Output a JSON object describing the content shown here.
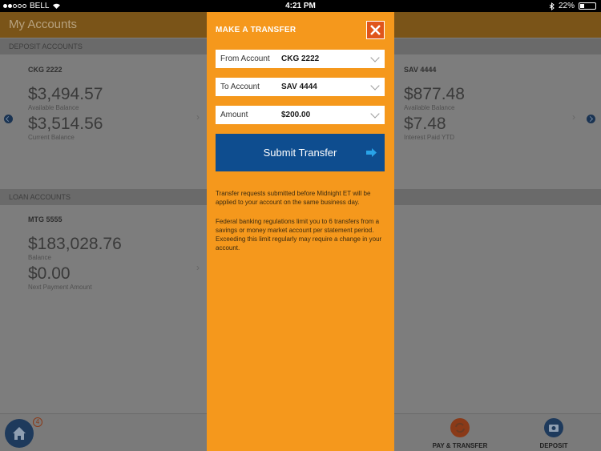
{
  "status_bar": {
    "carrier": "BELL",
    "time": "4:21 PM",
    "battery": "22%"
  },
  "app": {
    "title": "My Accounts",
    "deposit_header": "DEPOSIT ACCOUNTS",
    "loan_header": "LOAN ACCOUNTS",
    "deposit_cards": [
      {
        "name": "CKG 2222",
        "balance": "$3,494.57",
        "balance_label": "Available Balance",
        "current": "$3,514.56",
        "current_label": "Current Balance"
      },
      {
        "name": "SAV 4444",
        "balance": "$877.48",
        "balance_label": "Available Balance",
        "interest": "$7.48",
        "interest_label": "Interest Paid YTD"
      }
    ],
    "loan_cards": [
      {
        "name": "MTG 5555",
        "balance": "$183,028.76",
        "balance_label": "Balance",
        "next_payment": "$0.00",
        "next_payment_label": "Next Payment Amount"
      }
    ],
    "bottom_nav": {
      "home_badge": "4",
      "pay_transfer": "PAY & TRANSFER",
      "deposit": "DEPOSIT"
    }
  },
  "modal": {
    "title": "MAKE A TRANSFER",
    "close_icon": "close-icon",
    "from": {
      "label": "From Account",
      "value": "CKG 2222"
    },
    "to": {
      "label": "To Account",
      "value": "SAV 4444"
    },
    "amount": {
      "label": "Amount",
      "value": "$200.00"
    },
    "submit_label": "Submit Transfer",
    "note1": "Transfer requests submitted before Midnight ET will be applied to your account on the same business day.",
    "note2": "Federal banking regulations limit you to 6 transfers from a savings or money market account per statement period. Exceeding this limit regularly may require a change in your account."
  },
  "colors": {
    "modal_bg": "#f5981c",
    "submit_bg": "#0e4d8f",
    "close_bg": "#e0551b",
    "arrow": "#29a3e8"
  }
}
